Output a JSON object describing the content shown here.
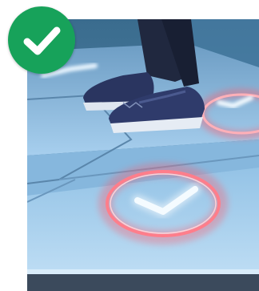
{
  "badge": {
    "icon": "check-mark-icon",
    "color": "#17a25a",
    "mark_color": "#ffffff"
  },
  "photo": {
    "floor_color": "#7fb4da",
    "glow_ring_color": "#ff5a6a",
    "glow_check_color": "#f4fbff",
    "shoe_color": "#2a3560"
  }
}
